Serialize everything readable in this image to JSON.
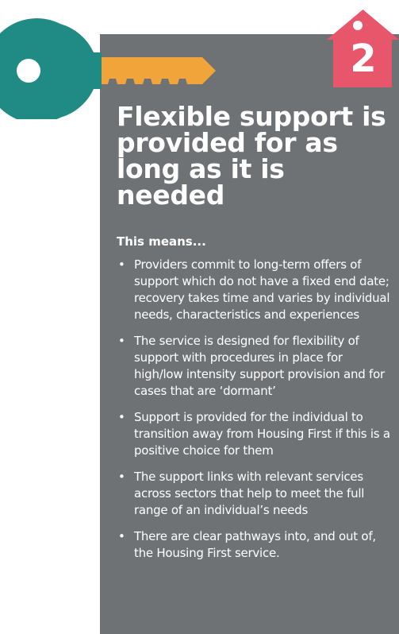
{
  "colors": {
    "panel": "#6f7275",
    "key_bow": "#1f8b84",
    "key_blade": "#f0a43a",
    "house": "#e8566b",
    "text": "#ffffff"
  },
  "badge": {
    "number": "2",
    "icon": "house-icon"
  },
  "heading": {
    "title": "Flexible support is provided for as long as it is needed",
    "subtitle": "This means..."
  },
  "bullets": [
    "Providers commit to long-term offers of support which do not have a fixed end date; recovery takes time and varies by individual needs, characteristics and experiences",
    "The service is designed for flexibility of support with procedures in place for high/low intensity support provision and for cases that are ‘dormant’",
    "Support is provided for the individual to transition away from Housing First if this is a positive choice for them",
    "The support links with relevant services across sectors that help to meet the full range of an individual’s needs",
    "There are clear pathways into, and out of, the Housing First service."
  ]
}
